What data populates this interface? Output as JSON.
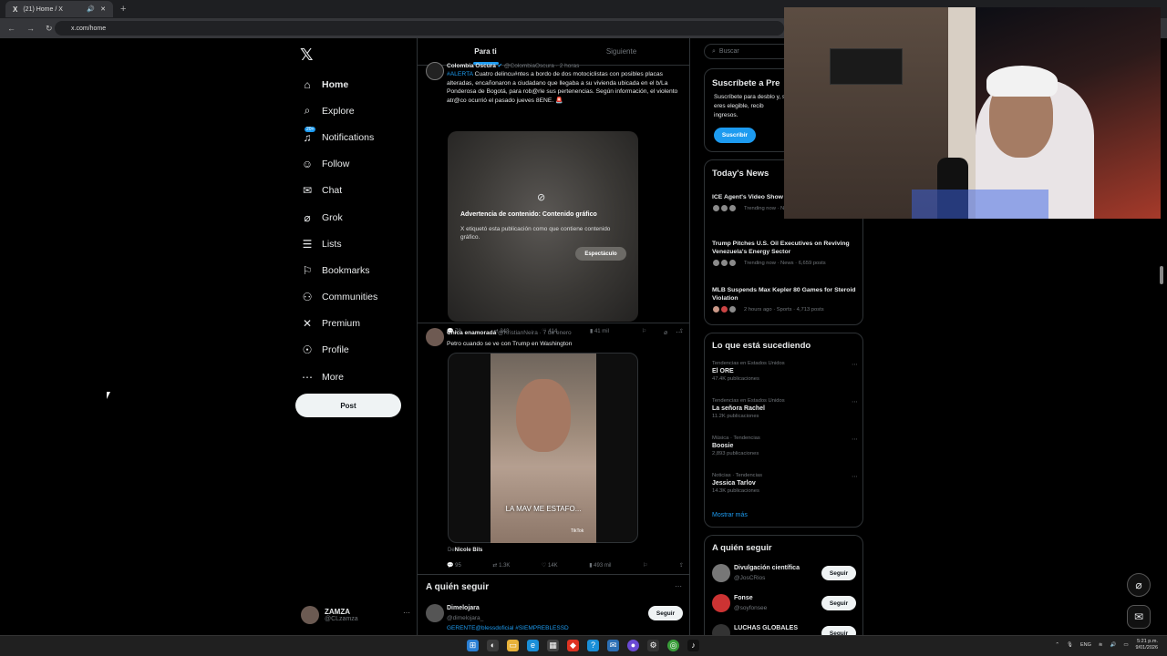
{
  "browser": {
    "tab_title": "(21) Home / X",
    "url": "x.com/home",
    "new_tab": "+"
  },
  "nav": {
    "items": [
      {
        "label": "Home",
        "icon": "home-icon",
        "glyph": "⌂"
      },
      {
        "label": "Explore",
        "icon": "search-icon",
        "glyph": "⌕"
      },
      {
        "label": "Notifications",
        "icon": "bell-icon",
        "glyph": "♫",
        "badge": "20+"
      },
      {
        "label": "Follow",
        "icon": "person-add-icon",
        "glyph": "☺"
      },
      {
        "label": "Chat",
        "icon": "mail-icon",
        "glyph": "✉"
      },
      {
        "label": "Grok",
        "icon": "grok-icon",
        "glyph": "⌀"
      },
      {
        "label": "Lists",
        "icon": "list-icon",
        "glyph": "☰"
      },
      {
        "label": "Bookmarks",
        "icon": "bookmark-icon",
        "glyph": "⚐"
      },
      {
        "label": "Communities",
        "icon": "communities-icon",
        "glyph": "⚇"
      },
      {
        "label": "Premium",
        "icon": "x-icon",
        "glyph": "✕"
      },
      {
        "label": "Profile",
        "icon": "profile-icon",
        "glyph": "☉"
      },
      {
        "label": "More",
        "icon": "more-icon",
        "glyph": "⋯"
      }
    ],
    "post_label": "Post"
  },
  "account": {
    "name": "ZAMZA",
    "handle": "@CLzamza",
    "more": "···"
  },
  "feed": {
    "tabs": [
      "Para ti",
      "Siguiente"
    ],
    "tweet1": {
      "author": "Colombia Oscura",
      "handle": "@ColombiaOscura · 2 horas",
      "text_hashtag": "#ALERTA",
      "text": "Cuatro delincu#ntes a bordo de dos motociclistas con posibles placas alteradas, encañonaron a ciudadano que llegaba a su vivienda ubicada en el b/La Ponderosa de Bogotá, para rob@rle sus pertenencias. Según información, el violento atr@co ocurrió el pasado jueves 8ENE. 🚨",
      "warning_title": "Advertencia de contenido: Contenido gráfico",
      "warning_text": "X etiquetó esta publicación como que contiene contenido gráfico.",
      "warning_button": "Espectáculo",
      "replies": "78",
      "reposts": "243",
      "likes": "414",
      "views": "41 mil"
    },
    "tweet2": {
      "author": "Chica enamorada",
      "handle": "@KristianNeira · 7 de enero",
      "text": "Petro cuando se ve con Trump en Washington",
      "video_caption": "LA MAV ME ESTAFO...",
      "video_tag": "TikTok",
      "from_prefix": "De",
      "from_name": "Nicole Bils",
      "replies": "95",
      "reposts": "1.3K",
      "likes": "14K",
      "views": "493 mil"
    },
    "who_to_follow": {
      "title": "A quién seguir",
      "name": "Dimelojara",
      "handle": "@dimelojara_",
      "bio": "GERENTE@blessdoficial #SIEMPREBLESSD",
      "follow": "Seguir"
    }
  },
  "sidebar": {
    "search_placeholder": "Buscar",
    "premium": {
      "title": "Suscríbete a Pre",
      "text": "Suscríbete para desblo y, si eres elegible, recib ingresos.",
      "button": "Suscribir"
    },
    "news": {
      "title": "Today's News",
      "items": [
        {
          "title": "ICE Agent's Video Show Confrontation with U.S.",
          "meta": "Trending now · News · 495K posts"
        },
        {
          "title": "Trump Pitches U.S. Oil Executives on Reviving Venezuela's Energy Sector",
          "meta": "Trending now · News · 6,659 posts"
        },
        {
          "title": "MLB Suspends Max Kepler 80 Games for Steroid Violation",
          "meta": "2 hours ago · Sports · 4,713 posts"
        }
      ]
    },
    "trends": {
      "title": "Lo que está sucediendo",
      "items": [
        {
          "cat": "Tendencias en Estados Unidos",
          "name": "El ORE",
          "count": "47.4K publicaciones"
        },
        {
          "cat": "Tendencias en Estados Unidos",
          "name": "La señora Rachel",
          "count": "11.2K publicaciones"
        },
        {
          "cat": "Música · Tendencias",
          "name": "Boosie",
          "count": "2,893 publicaciones"
        },
        {
          "cat": "Noticias · Tendencias",
          "name": "Jessica Tarlov",
          "count": "14.3K publicaciones"
        }
      ],
      "show_more": "Mostrar más"
    },
    "follow": {
      "title": "A quién seguir",
      "items": [
        {
          "name": "Divulgación científica",
          "handle": "@JosCRios"
        },
        {
          "name": "Fonse",
          "handle": "@soyfonsee"
        },
        {
          "name": "LUCHAS GLOBALES",
          "handle": ""
        }
      ],
      "button": "Seguir"
    }
  },
  "taskbar": {
    "lang": "ENG",
    "time": "5:21 p.m.",
    "date": "9/01/2026"
  }
}
